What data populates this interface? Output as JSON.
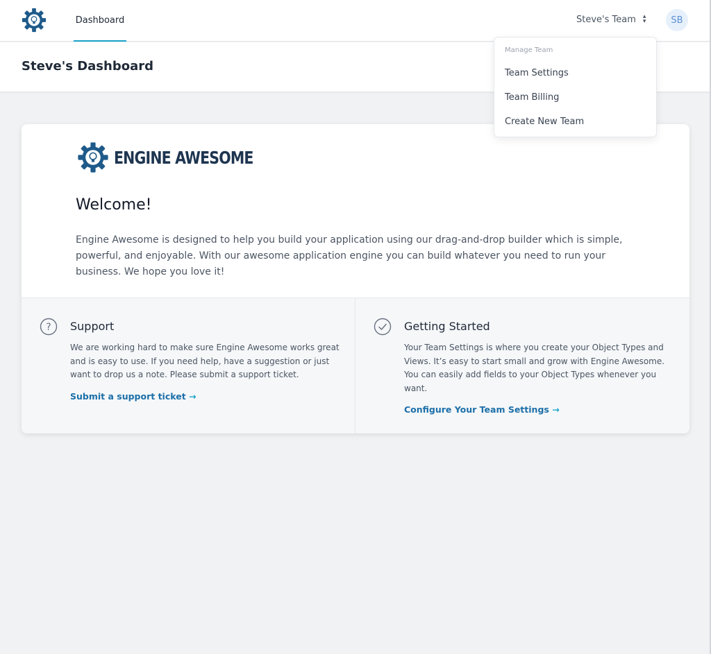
{
  "nav": {
    "tab": "Dashboard",
    "team_name": "Steve's Team",
    "avatar_initials": "SB"
  },
  "page": {
    "title": "Steve's Dashboard"
  },
  "dropdown": {
    "heading": "Manage Team",
    "items": [
      "Team Settings",
      "Team Billing",
      "Create New Team"
    ]
  },
  "card": {
    "brand": "ENGINE AWESOME",
    "welcome": "Welcome!",
    "intro": "Engine Awesome is designed to help you build your application using our drag-and-drop builder which is simple, powerful, and enjoyable. With our awesome application engine you can build whatever you need to run your business. We hope you love it!",
    "support": {
      "title": "Support",
      "text": "We are working hard to make sure Engine Awesome works great and is easy to use. If you need help, have a suggestion or just want to drop us a note. Please submit a support ticket.",
      "link": "Submit a support ticket"
    },
    "getting_started": {
      "title": "Getting Started",
      "text": "Your Team Settings is where you create your Object Types and Views. It’s easy to start small and grow with Engine Awesome. You can easily add fields to your Object Types whenever you want.",
      "link": "Configure Your Team Settings"
    }
  },
  "colors": {
    "accent": "#1aa3c9",
    "brand_dark": "#1e3550",
    "link": "#1c6fa8",
    "avatar_bg": "#e6f0fb"
  },
  "icons": {
    "logo": "gear-lightbulb-icon",
    "switcher": "chevron-up-down-icon",
    "support": "question-circle-icon",
    "getting_started": "check-circle-icon",
    "link_arrow": "arrow-right-icon"
  }
}
